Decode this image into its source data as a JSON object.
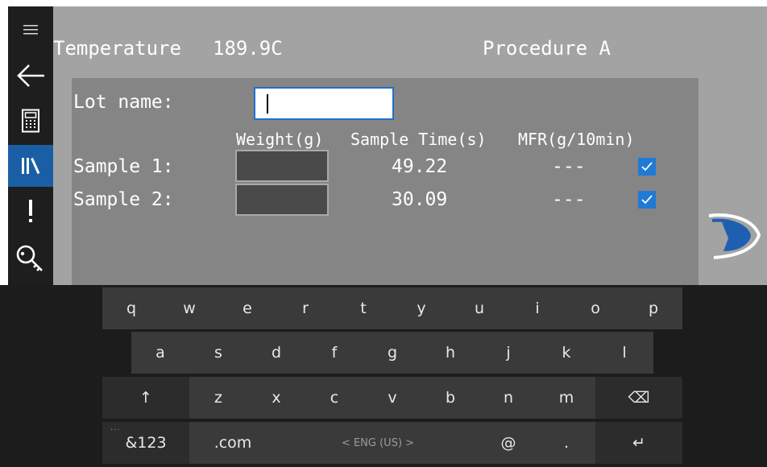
{
  "header": {
    "temperature_label": "Temperature",
    "temperature_value": "189.9C",
    "procedure": "Procedure A"
  },
  "sidebar": {
    "items": [
      {
        "name": "menu-icon"
      },
      {
        "name": "back-arrow-icon"
      },
      {
        "name": "calculator-icon"
      },
      {
        "name": "library-icon",
        "active": true
      },
      {
        "name": "alert-icon"
      },
      {
        "name": "key-icon"
      }
    ],
    "active_color": "#1a5fa6"
  },
  "form": {
    "lot_label": "Lot name:",
    "lot_value": "",
    "columns": {
      "weight": "Weight(g)",
      "sample_time": "Sample Time(s)",
      "mfr": "MFR(g/10min)"
    },
    "samples": [
      {
        "label": "Sample 1:",
        "weight": "",
        "time": "49.22",
        "mfr": "---",
        "checked": true
      },
      {
        "label": "Sample 2:",
        "weight": "",
        "time": "30.09",
        "mfr": "---",
        "checked": true
      }
    ]
  },
  "keyboard": {
    "row1": [
      "q",
      "w",
      "e",
      "r",
      "t",
      "y",
      "u",
      "i",
      "o",
      "p"
    ],
    "row2": [
      "a",
      "s",
      "d",
      "f",
      "g",
      "h",
      "j",
      "k",
      "l"
    ],
    "row3": [
      "z",
      "x",
      "c",
      "v",
      "b",
      "n",
      "m"
    ],
    "shift": "↑",
    "backspace": "⌫",
    "symbols": "&123",
    "symbols_dots": "...",
    "dotcom": ".com",
    "space": "< ENG (US) >",
    "at": "@",
    "period": ".",
    "enter": "↵"
  },
  "colors": {
    "background": "#a3a3a3",
    "panel": "#858585",
    "sidebar": "#1e1e1e",
    "accent": "#1f7ad6",
    "keyboard": "#1c1c1c",
    "key": "#3a3a3a"
  }
}
